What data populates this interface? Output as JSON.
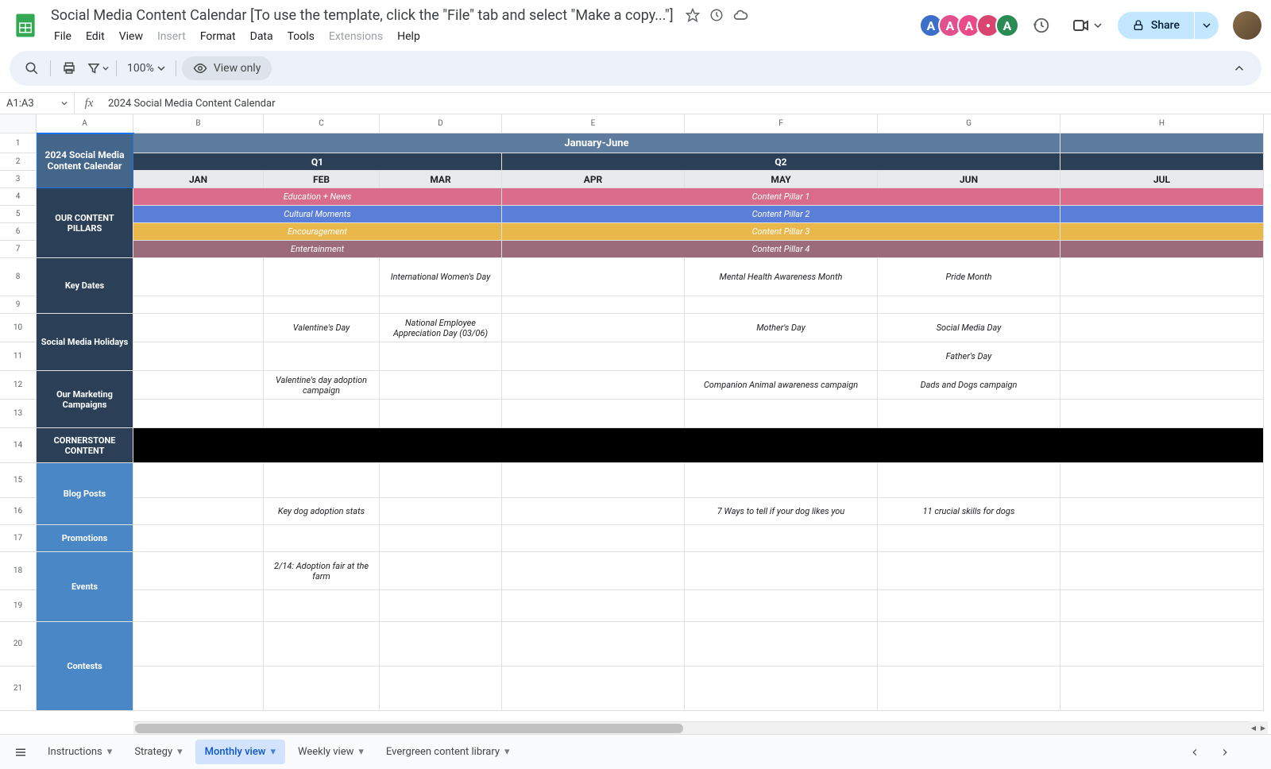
{
  "doc_title": "Social Media Content Calendar [To use the template, click the \"File\" tab and select \"Make a copy...\"]",
  "menubar": [
    "File",
    "Edit",
    "View",
    "Insert",
    "Format",
    "Data",
    "Tools",
    "Extensions",
    "Help"
  ],
  "menubar_disabled": [
    "Insert",
    "Extensions"
  ],
  "toolbar": {
    "zoom": "100%",
    "mode": "View only"
  },
  "formula": {
    "name_box": "A1:A3",
    "value": "2024 Social Media Content Calendar"
  },
  "share": "Share",
  "avatars": [
    {
      "bg": "#3b6fc9",
      "fg": "#fff",
      "char": "A"
    },
    {
      "bg": "#e2508f",
      "fg": "#fff",
      "char": "A"
    },
    {
      "bg": "#e94b8a",
      "fg": "#fff",
      "char": "A"
    },
    {
      "bg": "#d9456f",
      "fg": "#fff",
      "char": "●"
    },
    {
      "bg": "#2a8b54",
      "fg": "#fff",
      "char": "A"
    }
  ],
  "columns": [
    "A",
    "B",
    "C",
    "D",
    "E",
    "F",
    "G",
    "H"
  ],
  "row_numbers": [
    1,
    2,
    3,
    4,
    5,
    6,
    7,
    8,
    9,
    10,
    11,
    12,
    13,
    14,
    15,
    16,
    17,
    18,
    19,
    20,
    21
  ],
  "grid": {
    "title": "2024 Social Media Content Calendar",
    "half": "January-June",
    "q1": "Q1",
    "q2": "Q2",
    "months": [
      "JAN",
      "FEB",
      "MAR",
      "APR",
      "MAY",
      "JUN",
      "JUL"
    ],
    "pillars_label": "OUR CONTENT PILLARS",
    "pillar1_l": "Education + News",
    "pillar1_r": "Content Pillar 1",
    "pillar2_l": "Cultural Moments",
    "pillar2_r": "Content Pillar 2",
    "pillar3_l": "Encouragement",
    "pillar3_r": "Content Pillar 3",
    "pillar4_l": "Entertainment",
    "pillar4_r": "Content Pillar 4",
    "keydates": "Key Dates",
    "r8d": "International Women's Day",
    "r8f": "Mental Health Awareness Month",
    "r8g": "Pride Month",
    "smh": "Social Media Holidays",
    "r10c": "Valentine's Day",
    "r10d": "National Employee Appreciation Day (03/06)",
    "r10f": "Mother's Day",
    "r10g": "Social Media Day",
    "r11g": "Father's Day",
    "mkt": "Our Marketing Campaigns",
    "r12c": "Valentine's day adoption campaign",
    "r12f": "Companion Animal awareness campaign",
    "r12g": "Dads and Dogs campaign",
    "corner": "CORNERSTONE CONTENT",
    "blog": "Blog Posts",
    "r16c": "Key dog adoption stats",
    "r16f": "7 Ways to tell if your dog likes you",
    "r16g": "11 crucial skills for dogs",
    "promo": "Promotions",
    "events": "Events",
    "r18c": "2/14: Adoption fair at the farm",
    "contests": "Contests"
  },
  "tabs": [
    "Instructions",
    "Strategy",
    "Monthly view",
    "Weekly view",
    "Evergreen content library"
  ],
  "active_tab": "Monthly view"
}
